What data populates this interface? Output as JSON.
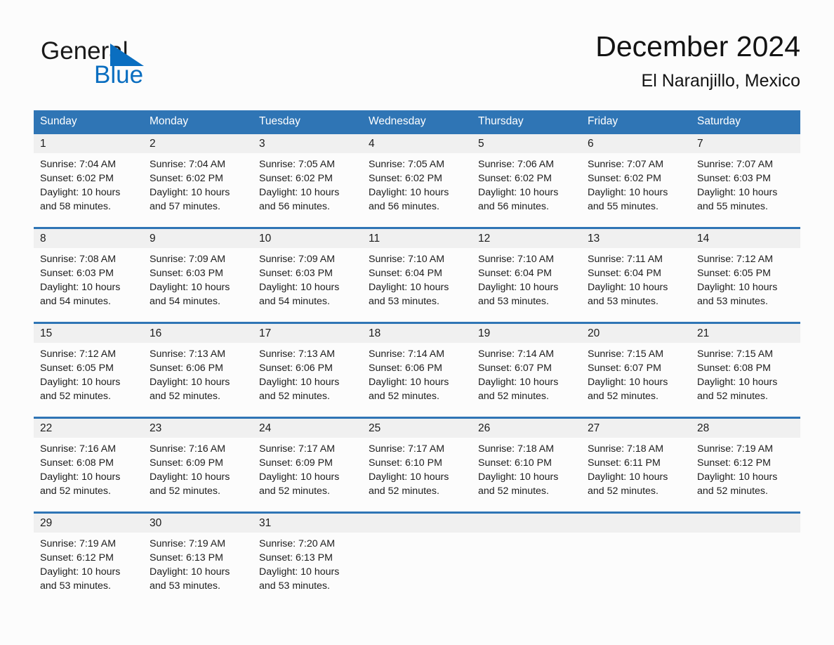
{
  "brand": {
    "name_part1": "General",
    "name_part2": "Blue",
    "accent_color": "#0a6ec0",
    "triangle_icon": "triangle-icon"
  },
  "header": {
    "month_title": "December 2024",
    "location": "El Naranjillo, Mexico"
  },
  "calendar": {
    "header_color": "#2f75b5",
    "band_color": "#f0f0f0",
    "weekdays": [
      "Sunday",
      "Monday",
      "Tuesday",
      "Wednesday",
      "Thursday",
      "Friday",
      "Saturday"
    ],
    "weeks": [
      [
        {
          "day": "1",
          "sunrise": "Sunrise: 7:04 AM",
          "sunset": "Sunset: 6:02 PM",
          "daylight_line1": "Daylight: 10 hours",
          "daylight_line2": "and 58 minutes."
        },
        {
          "day": "2",
          "sunrise": "Sunrise: 7:04 AM",
          "sunset": "Sunset: 6:02 PM",
          "daylight_line1": "Daylight: 10 hours",
          "daylight_line2": "and 57 minutes."
        },
        {
          "day": "3",
          "sunrise": "Sunrise: 7:05 AM",
          "sunset": "Sunset: 6:02 PM",
          "daylight_line1": "Daylight: 10 hours",
          "daylight_line2": "and 56 minutes."
        },
        {
          "day": "4",
          "sunrise": "Sunrise: 7:05 AM",
          "sunset": "Sunset: 6:02 PM",
          "daylight_line1": "Daylight: 10 hours",
          "daylight_line2": "and 56 minutes."
        },
        {
          "day": "5",
          "sunrise": "Sunrise: 7:06 AM",
          "sunset": "Sunset: 6:02 PM",
          "daylight_line1": "Daylight: 10 hours",
          "daylight_line2": "and 56 minutes."
        },
        {
          "day": "6",
          "sunrise": "Sunrise: 7:07 AM",
          "sunset": "Sunset: 6:02 PM",
          "daylight_line1": "Daylight: 10 hours",
          "daylight_line2": "and 55 minutes."
        },
        {
          "day": "7",
          "sunrise": "Sunrise: 7:07 AM",
          "sunset": "Sunset: 6:03 PM",
          "daylight_line1": "Daylight: 10 hours",
          "daylight_line2": "and 55 minutes."
        }
      ],
      [
        {
          "day": "8",
          "sunrise": "Sunrise: 7:08 AM",
          "sunset": "Sunset: 6:03 PM",
          "daylight_line1": "Daylight: 10 hours",
          "daylight_line2": "and 54 minutes."
        },
        {
          "day": "9",
          "sunrise": "Sunrise: 7:09 AM",
          "sunset": "Sunset: 6:03 PM",
          "daylight_line1": "Daylight: 10 hours",
          "daylight_line2": "and 54 minutes."
        },
        {
          "day": "10",
          "sunrise": "Sunrise: 7:09 AM",
          "sunset": "Sunset: 6:03 PM",
          "daylight_line1": "Daylight: 10 hours",
          "daylight_line2": "and 54 minutes."
        },
        {
          "day": "11",
          "sunrise": "Sunrise: 7:10 AM",
          "sunset": "Sunset: 6:04 PM",
          "daylight_line1": "Daylight: 10 hours",
          "daylight_line2": "and 53 minutes."
        },
        {
          "day": "12",
          "sunrise": "Sunrise: 7:10 AM",
          "sunset": "Sunset: 6:04 PM",
          "daylight_line1": "Daylight: 10 hours",
          "daylight_line2": "and 53 minutes."
        },
        {
          "day": "13",
          "sunrise": "Sunrise: 7:11 AM",
          "sunset": "Sunset: 6:04 PM",
          "daylight_line1": "Daylight: 10 hours",
          "daylight_line2": "and 53 minutes."
        },
        {
          "day": "14",
          "sunrise": "Sunrise: 7:12 AM",
          "sunset": "Sunset: 6:05 PM",
          "daylight_line1": "Daylight: 10 hours",
          "daylight_line2": "and 53 minutes."
        }
      ],
      [
        {
          "day": "15",
          "sunrise": "Sunrise: 7:12 AM",
          "sunset": "Sunset: 6:05 PM",
          "daylight_line1": "Daylight: 10 hours",
          "daylight_line2": "and 52 minutes."
        },
        {
          "day": "16",
          "sunrise": "Sunrise: 7:13 AM",
          "sunset": "Sunset: 6:06 PM",
          "daylight_line1": "Daylight: 10 hours",
          "daylight_line2": "and 52 minutes."
        },
        {
          "day": "17",
          "sunrise": "Sunrise: 7:13 AM",
          "sunset": "Sunset: 6:06 PM",
          "daylight_line1": "Daylight: 10 hours",
          "daylight_line2": "and 52 minutes."
        },
        {
          "day": "18",
          "sunrise": "Sunrise: 7:14 AM",
          "sunset": "Sunset: 6:06 PM",
          "daylight_line1": "Daylight: 10 hours",
          "daylight_line2": "and 52 minutes."
        },
        {
          "day": "19",
          "sunrise": "Sunrise: 7:14 AM",
          "sunset": "Sunset: 6:07 PM",
          "daylight_line1": "Daylight: 10 hours",
          "daylight_line2": "and 52 minutes."
        },
        {
          "day": "20",
          "sunrise": "Sunrise: 7:15 AM",
          "sunset": "Sunset: 6:07 PM",
          "daylight_line1": "Daylight: 10 hours",
          "daylight_line2": "and 52 minutes."
        },
        {
          "day": "21",
          "sunrise": "Sunrise: 7:15 AM",
          "sunset": "Sunset: 6:08 PM",
          "daylight_line1": "Daylight: 10 hours",
          "daylight_line2": "and 52 minutes."
        }
      ],
      [
        {
          "day": "22",
          "sunrise": "Sunrise: 7:16 AM",
          "sunset": "Sunset: 6:08 PM",
          "daylight_line1": "Daylight: 10 hours",
          "daylight_line2": "and 52 minutes."
        },
        {
          "day": "23",
          "sunrise": "Sunrise: 7:16 AM",
          "sunset": "Sunset: 6:09 PM",
          "daylight_line1": "Daylight: 10 hours",
          "daylight_line2": "and 52 minutes."
        },
        {
          "day": "24",
          "sunrise": "Sunrise: 7:17 AM",
          "sunset": "Sunset: 6:09 PM",
          "daylight_line1": "Daylight: 10 hours",
          "daylight_line2": "and 52 minutes."
        },
        {
          "day": "25",
          "sunrise": "Sunrise: 7:17 AM",
          "sunset": "Sunset: 6:10 PM",
          "daylight_line1": "Daylight: 10 hours",
          "daylight_line2": "and 52 minutes."
        },
        {
          "day": "26",
          "sunrise": "Sunrise: 7:18 AM",
          "sunset": "Sunset: 6:10 PM",
          "daylight_line1": "Daylight: 10 hours",
          "daylight_line2": "and 52 minutes."
        },
        {
          "day": "27",
          "sunrise": "Sunrise: 7:18 AM",
          "sunset": "Sunset: 6:11 PM",
          "daylight_line1": "Daylight: 10 hours",
          "daylight_line2": "and 52 minutes."
        },
        {
          "day": "28",
          "sunrise": "Sunrise: 7:19 AM",
          "sunset": "Sunset: 6:12 PM",
          "daylight_line1": "Daylight: 10 hours",
          "daylight_line2": "and 52 minutes."
        }
      ],
      [
        {
          "day": "29",
          "sunrise": "Sunrise: 7:19 AM",
          "sunset": "Sunset: 6:12 PM",
          "daylight_line1": "Daylight: 10 hours",
          "daylight_line2": "and 53 minutes."
        },
        {
          "day": "30",
          "sunrise": "Sunrise: 7:19 AM",
          "sunset": "Sunset: 6:13 PM",
          "daylight_line1": "Daylight: 10 hours",
          "daylight_line2": "and 53 minutes."
        },
        {
          "day": "31",
          "sunrise": "Sunrise: 7:20 AM",
          "sunset": "Sunset: 6:13 PM",
          "daylight_line1": "Daylight: 10 hours",
          "daylight_line2": "and 53 minutes."
        },
        {
          "day": "",
          "sunrise": "",
          "sunset": "",
          "daylight_line1": "",
          "daylight_line2": ""
        },
        {
          "day": "",
          "sunrise": "",
          "sunset": "",
          "daylight_line1": "",
          "daylight_line2": ""
        },
        {
          "day": "",
          "sunrise": "",
          "sunset": "",
          "daylight_line1": "",
          "daylight_line2": ""
        },
        {
          "day": "",
          "sunrise": "",
          "sunset": "",
          "daylight_line1": "",
          "daylight_line2": ""
        }
      ]
    ]
  }
}
